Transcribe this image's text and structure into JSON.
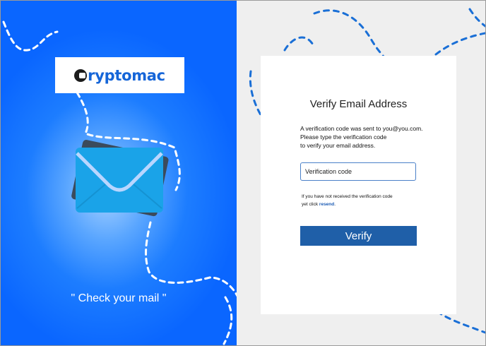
{
  "brand": {
    "logo_text": "ryptomac"
  },
  "left_panel": {
    "tagline": "\" Check your mail \""
  },
  "card": {
    "title": "Verify Email Address",
    "message_line1": "A verification code was sent to you@you.com.",
    "message_line2": "Please type the verification code",
    "message_line3": "to verify your email address.",
    "code_input_value": "",
    "code_input_placeholder": "Verification code",
    "help_line1": "If you have not received the verification code",
    "help_line2_prefix": "yet click ",
    "resend_link": "resend",
    "help_line2_suffix": ".",
    "verify_button": "Verify"
  },
  "colors": {
    "left_panel_blue": "#0a66ff",
    "right_panel_gray": "#efefef",
    "accent_blue": "#1f5fa8",
    "logo_blue": "#1565d8",
    "envelope_front": "#1aa3e8",
    "envelope_back": "#3b4b5c"
  },
  "icons": {
    "envelope": "envelope-icon",
    "logo_mark": "logo-c-icon"
  }
}
